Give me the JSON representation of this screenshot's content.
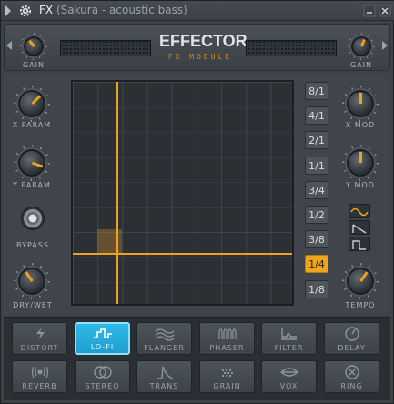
{
  "window": {
    "title": "FX",
    "subtitle": "(Sakura - acoustic bass)"
  },
  "header": {
    "logo_title": "EFFECTOR",
    "logo_subtitle": "FX MODULE",
    "gain_left_label": "GAIN",
    "gain_right_label": "GAIN"
  },
  "left_controls": {
    "x_param_label": "X PARAM",
    "y_param_label": "Y PARAM",
    "bypass_label": "BYPASS",
    "dry_wet_label": "DRY/WET"
  },
  "right_controls": {
    "x_mod_label": "X MOD",
    "y_mod_label": "Y MOD",
    "tempo_label": "TEMPO"
  },
  "tempo_divisions": [
    "8/1",
    "4/1",
    "2/1",
    "1/1",
    "3/4",
    "1/2",
    "3/8",
    "1/4",
    "1/8"
  ],
  "tempo_selected": "1/4",
  "mod_waveforms": [
    "sine-wave-icon",
    "saw-wave-icon",
    "square-wave-icon"
  ],
  "mod_waveform_selected": "sine-wave-icon",
  "effects_row1": [
    {
      "label": "DISTORT",
      "icon": "distort-icon"
    },
    {
      "label": "LO-FI",
      "icon": "lofi-icon"
    },
    {
      "label": "FLANGER",
      "icon": "flanger-icon"
    },
    {
      "label": "PHASER",
      "icon": "phaser-icon"
    },
    {
      "label": "FILTER",
      "icon": "filter-icon"
    },
    {
      "label": "DELAY",
      "icon": "delay-icon"
    }
  ],
  "effects_row2": [
    {
      "label": "REVERB",
      "icon": "reverb-icon"
    },
    {
      "label": "STEREO",
      "icon": "stereo-icon"
    },
    {
      "label": "TRANS",
      "icon": "trans-icon"
    },
    {
      "label": "GRAIN",
      "icon": "grain-icon"
    },
    {
      "label": "VOX",
      "icon": "vox-icon"
    },
    {
      "label": "RING",
      "icon": "ring-icon"
    }
  ],
  "effect_selected": "LO-FI",
  "colors": {
    "accent": "#f0a020",
    "selected_effect": "#1e9fd0",
    "panel": "#3f454a"
  }
}
